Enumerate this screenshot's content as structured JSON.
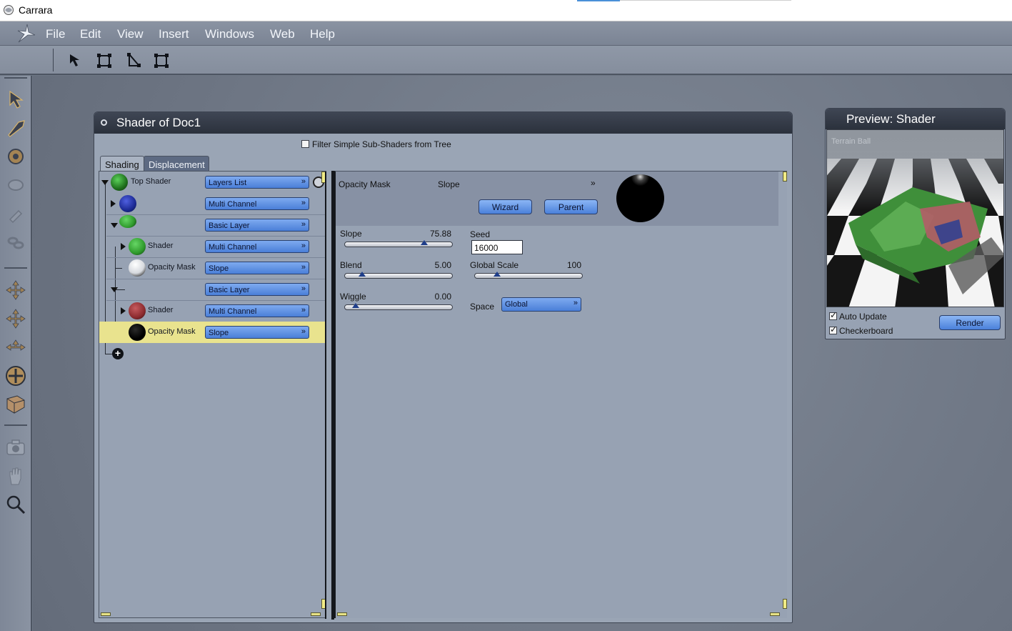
{
  "window": {
    "app_title": "Carrara"
  },
  "menu": [
    "File",
    "Edit",
    "View",
    "Insert",
    "Windows",
    "Web",
    "Help"
  ],
  "shader_window": {
    "title": "Shader of Doc1",
    "filter_label": "Filter Simple Sub-Shaders from Tree",
    "tabs": [
      "Shading",
      "Displacement"
    ],
    "tree": [
      {
        "label": "Top Shader",
        "combo": "Layers List",
        "ball": "#2e8f2a"
      },
      {
        "label": "",
        "combo": "Multi Channel",
        "ball": "#1c2a94"
      },
      {
        "label": "",
        "combo": "Basic Layer",
        "ball": "#2f9a2c"
      },
      {
        "label": "Shader",
        "combo": "Multi Channel",
        "ball": "#2f9a2c"
      },
      {
        "label": "Opacity Mask",
        "combo": "Slope",
        "ball": "#e4e6ea"
      },
      {
        "label": "",
        "combo": "Basic Layer",
        "ball": ""
      },
      {
        "label": "Shader",
        "combo": "Multi Channel",
        "ball": "#8c2b2f"
      },
      {
        "label": "Opacity Mask",
        "combo": "Slope",
        "ball": "#000000"
      }
    ],
    "props": {
      "channel_label": "Opacity Mask",
      "channel_value": "Slope",
      "wizard_button": "Wizard",
      "parent_button": "Parent",
      "slope": {
        "label": "Slope",
        "value": "75.88",
        "fraction": 0.76
      },
      "blend": {
        "label": "Blend",
        "value": "5.00",
        "fraction": 0.1
      },
      "wiggle": {
        "label": "Wiggle",
        "value": "0.00",
        "fraction": 0.03
      },
      "seed": {
        "label": "Seed",
        "value": "16000"
      },
      "global_scale": {
        "label": "Global Scale",
        "value": "100",
        "fraction": 0.15
      },
      "space": {
        "label": "Space",
        "value": "Global"
      }
    }
  },
  "preview": {
    "title": "Preview: Shader",
    "image_label": "Terrain Ball",
    "auto_update_label": "Auto Update",
    "checkerboard_label": "Checkerboard",
    "render_button": "Render"
  }
}
